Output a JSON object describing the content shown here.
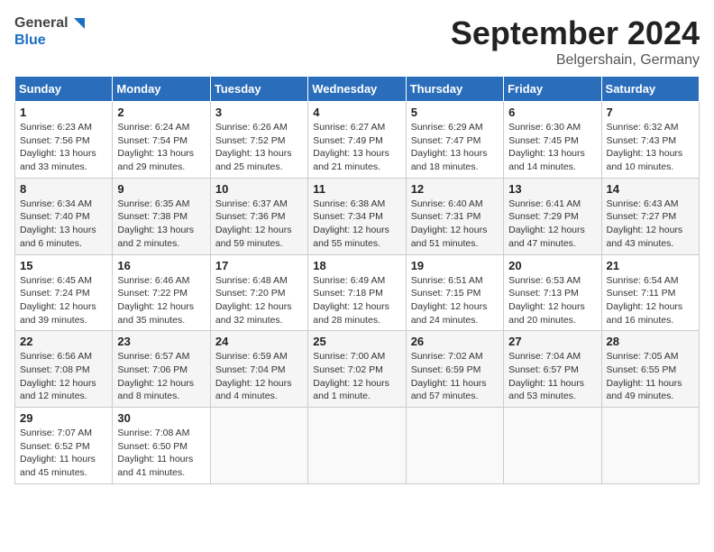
{
  "header": {
    "logo_general": "General",
    "logo_blue": "Blue",
    "month_title": "September 2024",
    "location": "Belgershain, Germany"
  },
  "days_of_week": [
    "Sunday",
    "Monday",
    "Tuesday",
    "Wednesday",
    "Thursday",
    "Friday",
    "Saturday"
  ],
  "weeks": [
    [
      {
        "day": "1",
        "sunrise": "6:23 AM",
        "sunset": "7:56 PM",
        "daylight": "13 hours and 33 minutes."
      },
      {
        "day": "2",
        "sunrise": "6:24 AM",
        "sunset": "7:54 PM",
        "daylight": "13 hours and 29 minutes."
      },
      {
        "day": "3",
        "sunrise": "6:26 AM",
        "sunset": "7:52 PM",
        "daylight": "13 hours and 25 minutes."
      },
      {
        "day": "4",
        "sunrise": "6:27 AM",
        "sunset": "7:49 PM",
        "daylight": "13 hours and 21 minutes."
      },
      {
        "day": "5",
        "sunrise": "6:29 AM",
        "sunset": "7:47 PM",
        "daylight": "13 hours and 18 minutes."
      },
      {
        "day": "6",
        "sunrise": "6:30 AM",
        "sunset": "7:45 PM",
        "daylight": "13 hours and 14 minutes."
      },
      {
        "day": "7",
        "sunrise": "6:32 AM",
        "sunset": "7:43 PM",
        "daylight": "13 hours and 10 minutes."
      }
    ],
    [
      {
        "day": "8",
        "sunrise": "6:34 AM",
        "sunset": "7:40 PM",
        "daylight": "13 hours and 6 minutes."
      },
      {
        "day": "9",
        "sunrise": "6:35 AM",
        "sunset": "7:38 PM",
        "daylight": "13 hours and 2 minutes."
      },
      {
        "day": "10",
        "sunrise": "6:37 AM",
        "sunset": "7:36 PM",
        "daylight": "12 hours and 59 minutes."
      },
      {
        "day": "11",
        "sunrise": "6:38 AM",
        "sunset": "7:34 PM",
        "daylight": "12 hours and 55 minutes."
      },
      {
        "day": "12",
        "sunrise": "6:40 AM",
        "sunset": "7:31 PM",
        "daylight": "12 hours and 51 minutes."
      },
      {
        "day": "13",
        "sunrise": "6:41 AM",
        "sunset": "7:29 PM",
        "daylight": "12 hours and 47 minutes."
      },
      {
        "day": "14",
        "sunrise": "6:43 AM",
        "sunset": "7:27 PM",
        "daylight": "12 hours and 43 minutes."
      }
    ],
    [
      {
        "day": "15",
        "sunrise": "6:45 AM",
        "sunset": "7:24 PM",
        "daylight": "12 hours and 39 minutes."
      },
      {
        "day": "16",
        "sunrise": "6:46 AM",
        "sunset": "7:22 PM",
        "daylight": "12 hours and 35 minutes."
      },
      {
        "day": "17",
        "sunrise": "6:48 AM",
        "sunset": "7:20 PM",
        "daylight": "12 hours and 32 minutes."
      },
      {
        "day": "18",
        "sunrise": "6:49 AM",
        "sunset": "7:18 PM",
        "daylight": "12 hours and 28 minutes."
      },
      {
        "day": "19",
        "sunrise": "6:51 AM",
        "sunset": "7:15 PM",
        "daylight": "12 hours and 24 minutes."
      },
      {
        "day": "20",
        "sunrise": "6:53 AM",
        "sunset": "7:13 PM",
        "daylight": "12 hours and 20 minutes."
      },
      {
        "day": "21",
        "sunrise": "6:54 AM",
        "sunset": "7:11 PM",
        "daylight": "12 hours and 16 minutes."
      }
    ],
    [
      {
        "day": "22",
        "sunrise": "6:56 AM",
        "sunset": "7:08 PM",
        "daylight": "12 hours and 12 minutes."
      },
      {
        "day": "23",
        "sunrise": "6:57 AM",
        "sunset": "7:06 PM",
        "daylight": "12 hours and 8 minutes."
      },
      {
        "day": "24",
        "sunrise": "6:59 AM",
        "sunset": "7:04 PM",
        "daylight": "12 hours and 4 minutes."
      },
      {
        "day": "25",
        "sunrise": "7:00 AM",
        "sunset": "7:02 PM",
        "daylight": "12 hours and 1 minute."
      },
      {
        "day": "26",
        "sunrise": "7:02 AM",
        "sunset": "6:59 PM",
        "daylight": "11 hours and 57 minutes."
      },
      {
        "day": "27",
        "sunrise": "7:04 AM",
        "sunset": "6:57 PM",
        "daylight": "11 hours and 53 minutes."
      },
      {
        "day": "28",
        "sunrise": "7:05 AM",
        "sunset": "6:55 PM",
        "daylight": "11 hours and 49 minutes."
      }
    ],
    [
      {
        "day": "29",
        "sunrise": "7:07 AM",
        "sunset": "6:52 PM",
        "daylight": "11 hours and 45 minutes."
      },
      {
        "day": "30",
        "sunrise": "7:08 AM",
        "sunset": "6:50 PM",
        "daylight": "11 hours and 41 minutes."
      },
      null,
      null,
      null,
      null,
      null
    ]
  ]
}
